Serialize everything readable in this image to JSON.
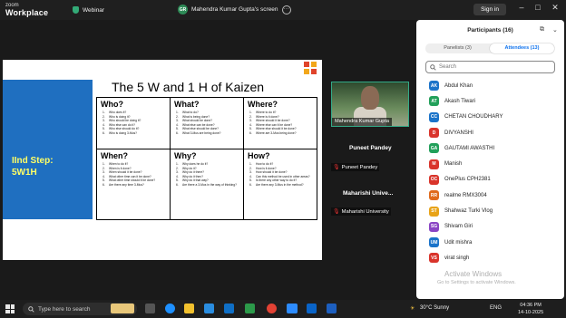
{
  "titlebar": {
    "logo_top": "zoom",
    "logo_bottom": "Workplace",
    "webinar_label": "Webinar",
    "share_badge": "GR",
    "share_title": "Mahendra Kumar Gupta's screen",
    "signin_label": "Sign in",
    "minimize": "–",
    "maximize": "□",
    "close": "✕"
  },
  "slide": {
    "title": "The 5 W and 1 H of Kaizen",
    "step_line1": "IInd Step:",
    "step_line2": "5W1H",
    "cells": [
      {
        "heading": "Who?",
        "items": [
          "Who does it?",
          "Who is doing it?",
          "Who should be doing it?",
          "Who else can do it?",
          "Who else should do it?",
          "Who is doing 3-Mus?"
        ]
      },
      {
        "heading": "What?",
        "items": [
          "What to do?",
          "What is being done?",
          "What should be done?",
          "What else can be done?",
          "What else should be done?",
          "What 3-Mus are being done?"
        ]
      },
      {
        "heading": "Where?",
        "items": [
          "Where to do it?",
          "Where is it done?",
          "Where should it be done?",
          "Where else can it be done?",
          "Where else should it be done?",
          "Where are 3-Mus being done?"
        ]
      },
      {
        "heading": "When?",
        "items": [
          "When to do it?",
          "When is it done?",
          "When should it be done?",
          "What other time can it be done?",
          "What other time should it be done?",
          "Are there any time 3-Mus?"
        ]
      },
      {
        "heading": "Why?",
        "items": [
          "Why does he do it?",
          "Why do it?",
          "Why do it there?",
          "Why do it then?",
          "Why do it that way?",
          "Are there a 3-Mus in the way of thinking?"
        ]
      },
      {
        "heading": "How?",
        "items": [
          "How to do it?",
          "How is it done?",
          "How should it be done?",
          "Can this method be used in other areas?",
          "Is there any other way to do it?",
          "Are there any 3-Mus in the method?"
        ]
      }
    ]
  },
  "video": {
    "speaker_label": "Mahendra Kumar Gupta"
  },
  "tiles": [
    {
      "title": "Puneet Pandey",
      "label": "Puneet Pandey"
    },
    {
      "title": "Maharishi Unive...",
      "label": "Maharishi University"
    }
  ],
  "panel": {
    "title": "Participants (16)",
    "tab_panelists": "Panelists (3)",
    "tab_attendees": "Attendees (13)",
    "search_placeholder": "Search",
    "attendees": [
      {
        "initials": "AK",
        "name": "Abdul Khan",
        "color": "#1a73c9"
      },
      {
        "initials": "AT",
        "name": "Akash Tiwari",
        "color": "#22a05a"
      },
      {
        "initials": "CC",
        "name": "CHETAN CHOUDHARY",
        "color": "#1a73c9"
      },
      {
        "initials": "D",
        "name": "DIVYANSHI",
        "color": "#d9342b"
      },
      {
        "initials": "GA",
        "name": "GAUTAMI AWASTHI",
        "color": "#22a05a"
      },
      {
        "initials": "M",
        "name": "Manish",
        "color": "#d9342b"
      },
      {
        "initials": "OC",
        "name": "OnePlus CPH2381",
        "color": "#d9342b"
      },
      {
        "initials": "RR",
        "name": "realme RMX3004",
        "color": "#e06a1c"
      },
      {
        "initials": "ST",
        "name": "Shahwaz Turki Vlog",
        "color": "#e8a317"
      },
      {
        "initials": "SG",
        "name": "Shivam Giri",
        "color": "#8a44c4"
      },
      {
        "initials": "UM",
        "name": "Udit mishra",
        "color": "#1a73c9"
      },
      {
        "initials": "VS",
        "name": "virat singh",
        "color": "#d9342b"
      }
    ],
    "watermark_line1": "Activate Windows",
    "watermark_line2": "Go to Settings to activate Windows."
  },
  "taskbar": {
    "search_placeholder": "Type here to search",
    "weather": "30°C  Sunny",
    "lang": "ENG",
    "time": "04:36 PM",
    "date": "14-10-2025"
  }
}
